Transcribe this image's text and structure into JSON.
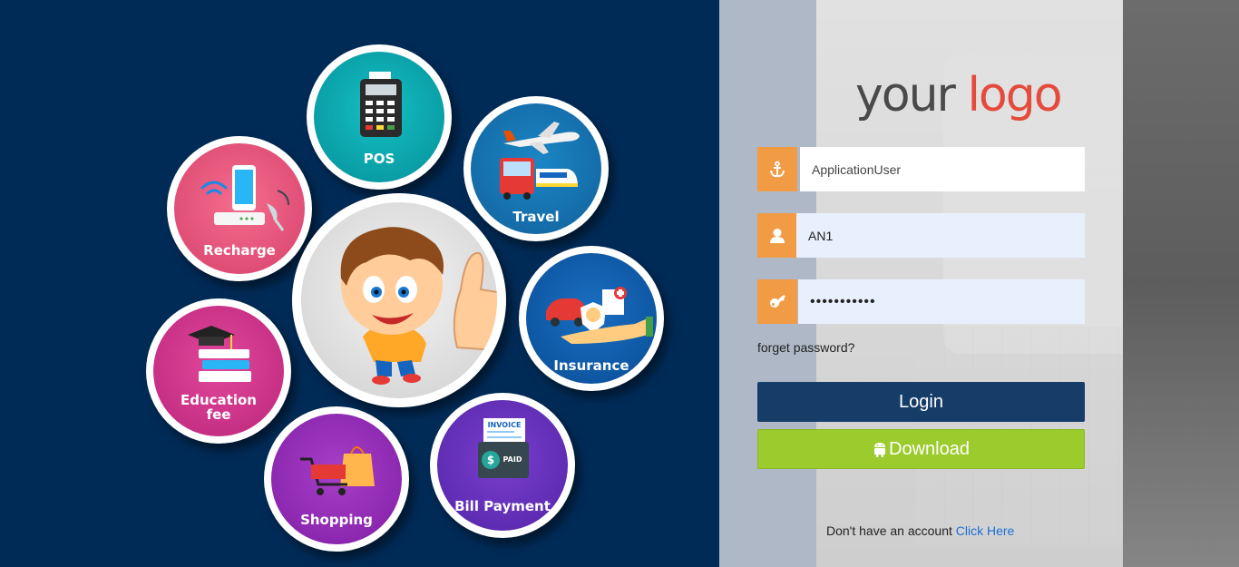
{
  "hero": {
    "bubbles": {
      "pos": "POS",
      "travel": "Travel",
      "recharge": "Recharge",
      "insurance": "Insurance",
      "education_line1": "Education",
      "education_line2": "fee",
      "shopping": "Shopping",
      "bill_payment": "Bill Payment",
      "invoice_text": "INVOICE",
      "paid_text": "PAID"
    }
  },
  "brand": {
    "logo_part1": "your",
    "logo_part2": "logo"
  },
  "form": {
    "application_user_value": "ApplicationUser",
    "login_id_value": "AN1",
    "password_value": "•••••••••••",
    "forgot_password": "forget password?",
    "login_button": "Login",
    "download_button": "Download"
  },
  "footer": {
    "no_account_text": "Don't have an account",
    "click_here_link": "Click Here"
  },
  "colors": {
    "hero_bg": "#002b57",
    "addon_orange": "#f29b45",
    "login_button": "#163d68",
    "download_button": "#9bcb2c",
    "logo_red": "#e54b3c",
    "link_blue": "#1d6fd6"
  }
}
